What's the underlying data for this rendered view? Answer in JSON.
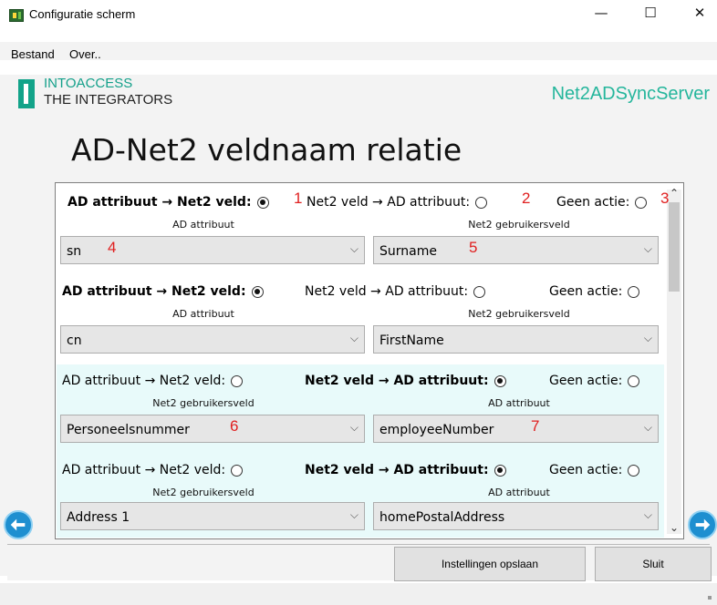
{
  "window": {
    "title": "Configuratie scherm",
    "minimize": "—",
    "maximize": "☐",
    "close": "✕"
  },
  "menu": {
    "bestand": "Bestand",
    "over": "Over.."
  },
  "logo": {
    "brand": "INTOACCESS",
    "tagline": "THE INTEGRATORS",
    "server": "Net2ADSyncServer"
  },
  "page_title": "AD-Net2 veldnaam relatie",
  "options": {
    "ad_to_net2": "AD attribuut → Net2 veld:",
    "net2_to_ad": "Net2 veld → AD attribuut:",
    "none": "Geen actie:"
  },
  "mappings": [
    {
      "direction": "ad_to_net2",
      "left_label": "AD attribuut",
      "left_value": "sn",
      "right_label": "Net2 gebruikersveld",
      "right_value": "Surname"
    },
    {
      "direction": "ad_to_net2",
      "left_label": "AD attribuut",
      "left_value": "cn",
      "right_label": "Net2 gebruikersveld",
      "right_value": "FirstName"
    },
    {
      "direction": "net2_to_ad",
      "left_label": "Net2 gebruikersveld",
      "left_value": "Personeelsnummer",
      "right_label": "AD attribuut",
      "right_value": "employeeNumber"
    },
    {
      "direction": "net2_to_ad",
      "left_label": "Net2 gebruikersveld",
      "left_value": "Address 1",
      "right_label": "AD attribuut",
      "right_value": "homePostalAddress"
    }
  ],
  "annotations": [
    "1",
    "2",
    "3",
    "4",
    "5",
    "6",
    "7"
  ],
  "buttons": {
    "save": "Instellingen opslaan",
    "close": "Sluit"
  },
  "icons": {
    "prev": "arrow-left-circle-icon",
    "next": "arrow-right-circle-icon",
    "chevron": "chevron-down-icon"
  },
  "colors": {
    "accent": "#14a08a",
    "highlight_row": "#e8fafa",
    "annotation": "#e02020",
    "nav_arrow": "#1e8fd0"
  }
}
